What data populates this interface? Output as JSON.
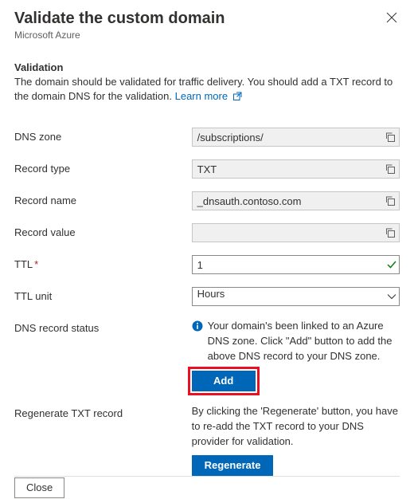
{
  "header": {
    "title": "Validate the custom domain",
    "subtitle": "Microsoft Azure"
  },
  "validation": {
    "heading": "Validation",
    "description": "The domain should be validated for traffic delivery. You should add a TXT record to the domain DNS for the validation. ",
    "learn_more": "Learn more"
  },
  "fields": {
    "dns_zone": {
      "label": "DNS zone",
      "value": "/subscriptions/"
    },
    "record_type": {
      "label": "Record type",
      "value": "TXT"
    },
    "record_name": {
      "label": "Record name",
      "value": "_dnsauth.contoso.com"
    },
    "record_value": {
      "label": "Record value",
      "value": ""
    },
    "ttl": {
      "label": "TTL",
      "value": "1"
    },
    "ttl_unit": {
      "label": "TTL unit",
      "value": "Hours"
    }
  },
  "dns_status": {
    "label": "DNS record status",
    "text": "Your domain's been linked to an Azure DNS zone. Click \"Add\" button to add the above DNS record to your DNS zone.",
    "add_button": "Add"
  },
  "regenerate": {
    "label": "Regenerate TXT record",
    "text": "By clicking the 'Regenerate' button, you have to re-add the TXT record to your DNS provider for validation.",
    "button": "Regenerate"
  },
  "footer": {
    "close_button": "Close"
  }
}
